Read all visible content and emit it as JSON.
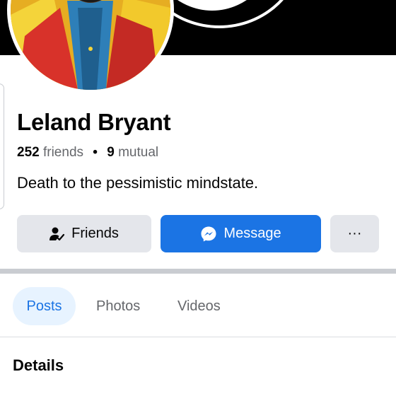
{
  "profile": {
    "name": "Leland Bryant",
    "friends_count": "252",
    "friends_label": "friends",
    "mutual_count": "9",
    "mutual_label": "mutual",
    "separator": "•",
    "bio": "Death to the pessimistic mindstate."
  },
  "actions": {
    "friends_label": "Friends",
    "message_label": "Message",
    "more_label": "···"
  },
  "tabs": [
    {
      "label": "Posts",
      "active": true
    },
    {
      "label": "Photos",
      "active": false
    },
    {
      "label": "Videos",
      "active": false
    }
  ],
  "section": {
    "details_title": "Details"
  },
  "colors": {
    "accent": "#1b74e4",
    "button_grey": "#e4e6eb",
    "active_tab_bg": "#e7f3ff",
    "muted_text": "#65676b"
  },
  "icons": {
    "friends": "friends-check-icon",
    "message": "messenger-icon",
    "more": "more-dots-icon"
  }
}
